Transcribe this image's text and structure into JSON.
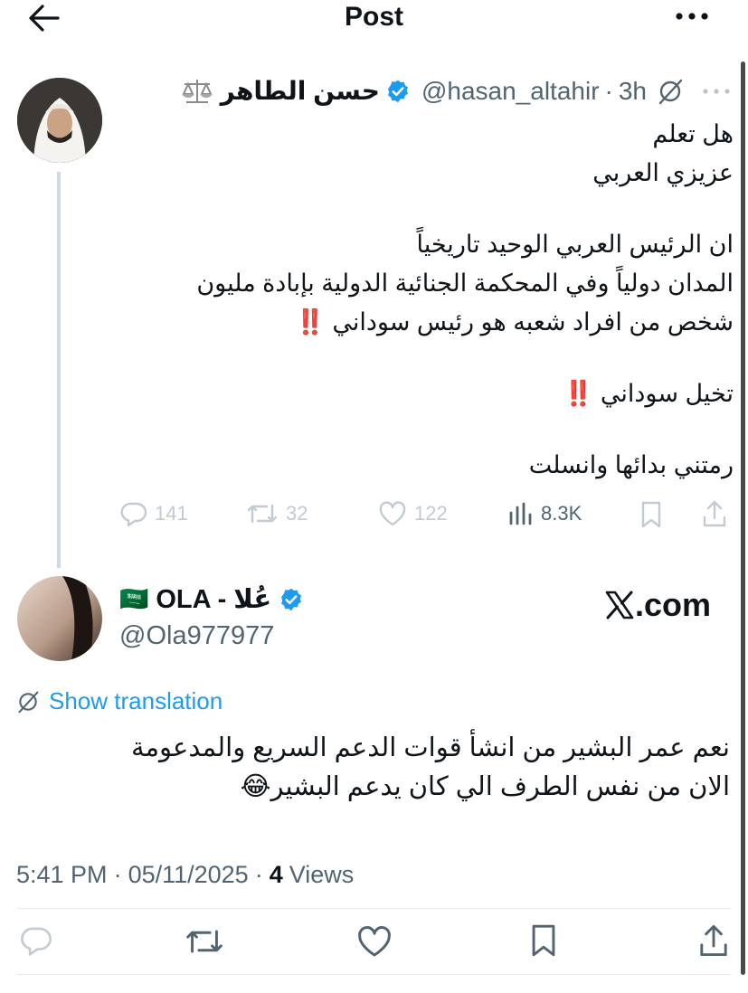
{
  "header": {
    "title": "Post"
  },
  "parent": {
    "name": "حسن الطاهر",
    "handle": "@hasan_altahir",
    "sep": "·",
    "time": "3h",
    "body": {
      "l1": "هل تعلم",
      "l2": "عزيزي العربي",
      "l3": "ان الرئيس العربي الوحيد تاريخياً",
      "l4": "المدان دولياً وفي المحكمة الجنائية الدولية بإبادة مليون",
      "l5": "شخص من افراد شعبه هو رئيس سوداني",
      "l6": "تخيل سوداني",
      "l7": "رمتني بدائها وانسلت",
      "bang": "‼️"
    },
    "stats": {
      "replies": "141",
      "reposts": "32",
      "likes": "122",
      "views": "8.3K"
    }
  },
  "reply": {
    "name": "OLA - عُلا",
    "flag": "🇸🇦",
    "handle": "@Ola977977",
    "watermark": ".com",
    "translate": "Show translation",
    "body": {
      "l1": "نعم عمر البشير من انشأ قوات الدعم السريع والمدعومة",
      "l2": "الان من نفس الطرف الي كان يدعم البشير",
      "emoji": "😂"
    },
    "meta": {
      "time": "5:41 PM",
      "sep1": "·",
      "date": "05/11/2025",
      "sep2": "·",
      "views_count": "4",
      "views_label": "Views"
    }
  },
  "colors": {
    "verified": "#1d9bf0",
    "link": "#1d9bf0",
    "text": "#0f1419",
    "muted": "#536471",
    "bang": "#e0262a"
  }
}
